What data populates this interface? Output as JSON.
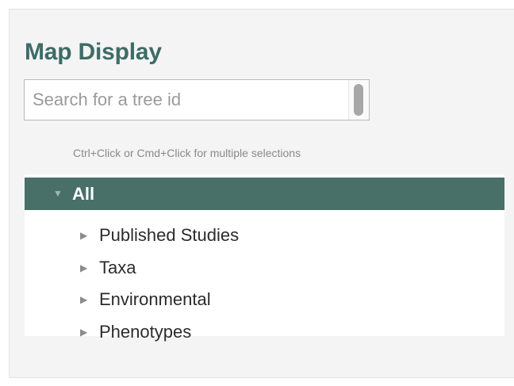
{
  "panel": {
    "title": "Map Display"
  },
  "search": {
    "placeholder": "Search for a tree id",
    "value": ""
  },
  "hint": "Ctrl+Click or Cmd+Click for multiple selections",
  "tree": {
    "root": {
      "label": "All",
      "expanded": true,
      "selected": true,
      "arrow_icon": "triangle-down-icon"
    },
    "items": [
      {
        "label": "Published Studies",
        "arrow_icon": "triangle-right-icon"
      },
      {
        "label": "Taxa",
        "arrow_icon": "triangle-right-icon"
      },
      {
        "label": "Environmental",
        "arrow_icon": "triangle-right-icon"
      },
      {
        "label": "Phenotypes",
        "arrow_icon": "triangle-right-icon"
      }
    ]
  },
  "colors": {
    "title": "#3e6c66",
    "selected_row": "#486f68",
    "panel_bg": "#f4f4f4"
  }
}
